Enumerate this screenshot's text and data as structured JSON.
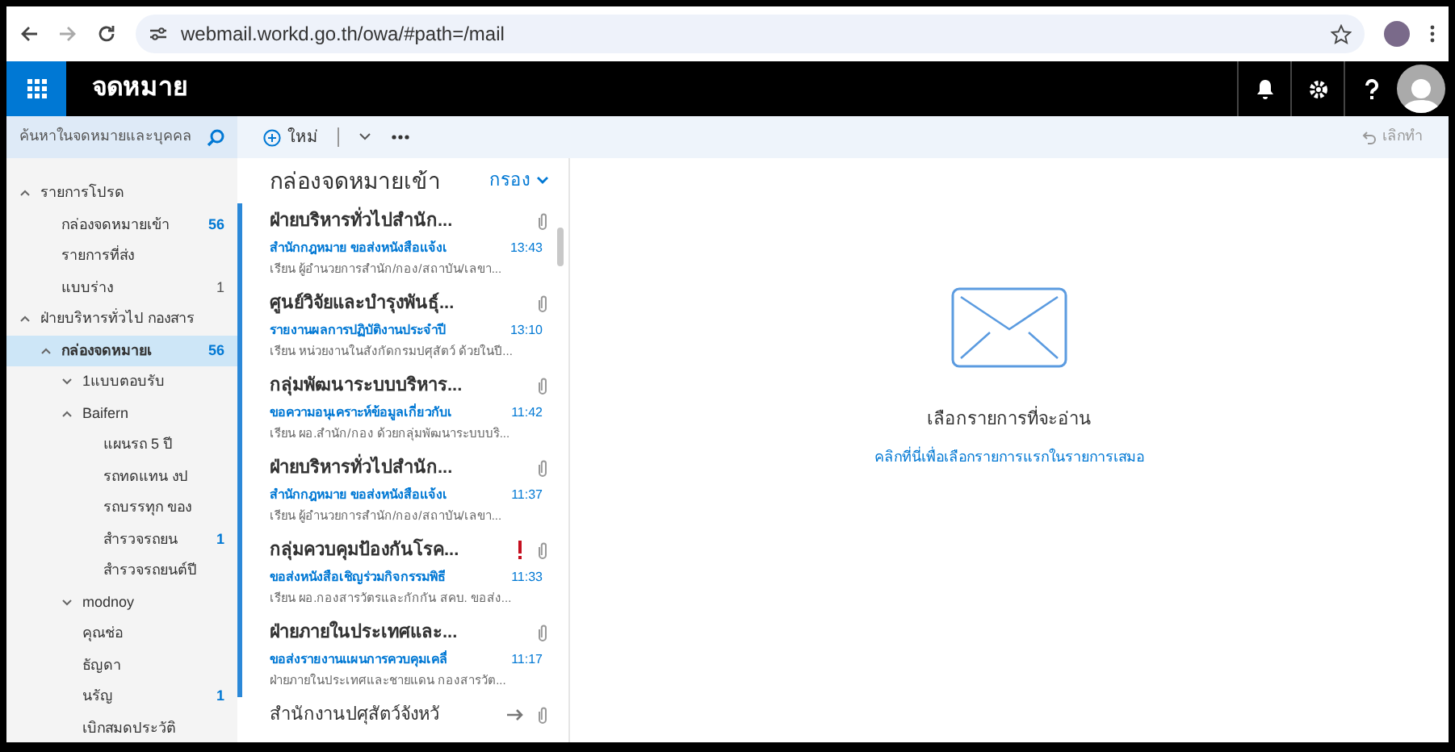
{
  "browser": {
    "url": "webmail.workd.go.th/owa/#path=/mail"
  },
  "app": {
    "title": "จดหมาย"
  },
  "search": {
    "placeholder": "ค้นหาในจดหมายและบุคคล"
  },
  "toolbar": {
    "new_label": "ใหม่",
    "undo_label": "เลิกทำ"
  },
  "folders": [
    {
      "label": "รายการโปรด",
      "expanded": true,
      "selected": false,
      "children": [
        {
          "label": "กล่องจดหมายเข้า",
          "selected": false,
          "count": "56",
          "unread": true
        },
        {
          "label": "รายการที่ส่ง",
          "selected": false
        },
        {
          "label": "แบบร่าง",
          "selected": false,
          "count": "1",
          "unread": false
        }
      ]
    },
    {
      "label": "ฝ่ายบริหารทั่วไป กองสาร",
      "expanded": true,
      "selected": false,
      "children": [
        {
          "label": "กล่องจดหมายเ",
          "expanded": true,
          "selected": true,
          "count": "56",
          "unread": true,
          "children": [
            {
              "label": "1แบบตอบรับ",
              "expanded": false,
              "selected": false
            },
            {
              "label": "Baifern",
              "expanded": true,
              "selected": false,
              "children": [
                {
                  "label": "แผนรถ 5 ปี",
                  "selected": false
                },
                {
                  "label": "รถทดแทน งป",
                  "selected": false
                },
                {
                  "label": "รถบรรทุก ของ",
                  "selected": false
                },
                {
                  "label": "สำรวจรถยน",
                  "selected": false,
                  "count": "1",
                  "unread": true
                },
                {
                  "label": "สำรวจรถยนต์ปี",
                  "selected": false
                }
              ]
            },
            {
              "label": "modnoy",
              "expanded": false,
              "selected": false
            },
            {
              "label": "คุณช่อ",
              "selected": false
            },
            {
              "label": "ธัญดา",
              "selected": false
            },
            {
              "label": "นรัญ",
              "selected": false,
              "count": "1",
              "unread": true
            },
            {
              "label": "เบิกสมดประวัติ",
              "selected": false
            }
          ]
        }
      ]
    }
  ],
  "list": {
    "title": "กล่องจดหมายเข้า",
    "filter_label": "กรอง"
  },
  "messages": [
    {
      "sender": "ฝ่ายบริหารทั่วไปสำนัก...",
      "subject": "สำนักกฎหมาย ขอส่งหนังสือแจ้งเ",
      "preview": "เรียน ผู้อำนวยการสำนัก/กอง/สถาบัน/เลขา...",
      "time": "13:43",
      "unread": true,
      "attachment": true,
      "important": false,
      "forwarded": false
    },
    {
      "sender": "ศูนย์วิจัยและบำรุงพันธุ์...",
      "subject": "รายงานผลการปฏิบัติงานประจำปี",
      "preview": "เรียน หน่วยงานในสังกัดกรมปศุสัตว์ ด้วยในปี...",
      "time": "13:10",
      "unread": true,
      "attachment": true,
      "important": false,
      "forwarded": false
    },
    {
      "sender": "กลุ่มพัฒนาระบบบริหาร...",
      "subject": "ขอความอนุเคราะห์ข้อมูลเกี่ยวกับเ",
      "preview": "เรียน ผอ.สำนัก/กอง ด้วยกลุ่มพัฒนาระบบบริ...",
      "time": "11:42",
      "unread": true,
      "attachment": true,
      "important": false,
      "forwarded": false
    },
    {
      "sender": "ฝ่ายบริหารทั่วไปสำนัก...",
      "subject": "สำนักกฎหมาย ขอส่งหนังสือแจ้งเ",
      "preview": "เรียน ผู้อำนวยการสำนัก/กอง/สถาบัน/เลขา...",
      "time": "11:37",
      "unread": true,
      "attachment": true,
      "important": false,
      "forwarded": false
    },
    {
      "sender": "กลุ่มควบคุมป้องกันโรค...",
      "subject": "ขอส่งหนังสือเชิญร่วมกิจกรรมพิธี",
      "preview": "เรียน ผอ.กองสารวัตรและกักกัน สคบ. ขอส่ง...",
      "time": "11:33",
      "unread": true,
      "attachment": true,
      "important": true,
      "forwarded": false
    },
    {
      "sender": "ฝ่ายภายในประเทศและ...",
      "subject": "ขอส่งรายงานแผนการควบคุมเคลื่",
      "preview": "ฝ่ายภายในประเทศและชายแดน กองสารวัต...",
      "time": "11:17",
      "unread": true,
      "attachment": true,
      "important": false,
      "forwarded": false
    },
    {
      "sender": "สำนักงานปศุสัตว์จังหวั",
      "unread": false,
      "attachment": true,
      "important": false,
      "forwarded": true
    }
  ],
  "reading_pane": {
    "heading": "เลือกรายการที่จะอ่าน",
    "link": "คลิกที่นี่เพื่อเลือกรายการแรกในรายการเสมอ"
  }
}
